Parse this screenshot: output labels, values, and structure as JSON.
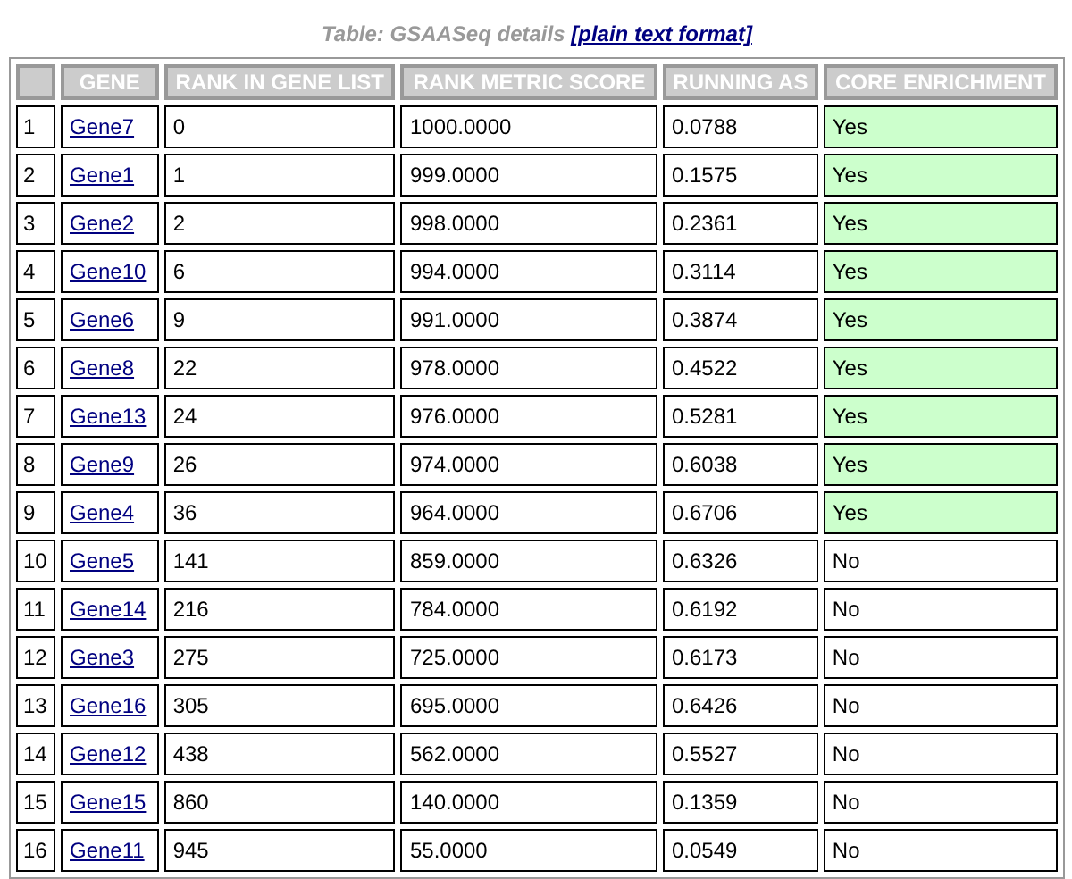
{
  "caption": {
    "title": "Table: GSAASeq details",
    "link": "[plain text format]"
  },
  "table": {
    "columns": [
      "",
      "GENE",
      "RANK IN GENE LIST",
      "RANK METRIC SCORE",
      "RUNNING AS",
      "CORE ENRICHMENT"
    ],
    "rows": [
      {
        "index": "1",
        "gene": "Gene7",
        "rank": "0",
        "score": "1000.0000",
        "running": "0.0788",
        "core": "Yes",
        "highlighted": true
      },
      {
        "index": "2",
        "gene": "Gene1",
        "rank": "1",
        "score": "999.0000",
        "running": "0.1575",
        "core": "Yes",
        "highlighted": true
      },
      {
        "index": "3",
        "gene": "Gene2",
        "rank": "2",
        "score": "998.0000",
        "running": "0.2361",
        "core": "Yes",
        "highlighted": true
      },
      {
        "index": "4",
        "gene": "Gene10",
        "rank": "6",
        "score": "994.0000",
        "running": "0.3114",
        "core": "Yes",
        "highlighted": true
      },
      {
        "index": "5",
        "gene": "Gene6",
        "rank": "9",
        "score": "991.0000",
        "running": "0.3874",
        "core": "Yes",
        "highlighted": true
      },
      {
        "index": "6",
        "gene": "Gene8",
        "rank": "22",
        "score": "978.0000",
        "running": "0.4522",
        "core": "Yes",
        "highlighted": true
      },
      {
        "index": "7",
        "gene": "Gene13",
        "rank": "24",
        "score": "976.0000",
        "running": "0.5281",
        "core": "Yes",
        "highlighted": true
      },
      {
        "index": "8",
        "gene": "Gene9",
        "rank": "26",
        "score": "974.0000",
        "running": "0.6038",
        "core": "Yes",
        "highlighted": true
      },
      {
        "index": "9",
        "gene": "Gene4",
        "rank": "36",
        "score": "964.0000",
        "running": "0.6706",
        "core": "Yes",
        "highlighted": true
      },
      {
        "index": "10",
        "gene": "Gene5",
        "rank": "141",
        "score": "859.0000",
        "running": "0.6326",
        "core": "No",
        "highlighted": false
      },
      {
        "index": "11",
        "gene": "Gene14",
        "rank": "216",
        "score": "784.0000",
        "running": "0.6192",
        "core": "No",
        "highlighted": false
      },
      {
        "index": "12",
        "gene": "Gene3",
        "rank": "275",
        "score": "725.0000",
        "running": "0.6173",
        "core": "No",
        "highlighted": false
      },
      {
        "index": "13",
        "gene": "Gene16",
        "rank": "305",
        "score": "695.0000",
        "running": "0.6426",
        "core": "No",
        "highlighted": false
      },
      {
        "index": "14",
        "gene": "Gene12",
        "rank": "438",
        "score": "562.0000",
        "running": "0.5527",
        "core": "No",
        "highlighted": false
      },
      {
        "index": "15",
        "gene": "Gene15",
        "rank": "860",
        "score": "140.0000",
        "running": "0.1359",
        "core": "No",
        "highlighted": false
      },
      {
        "index": "16",
        "gene": "Gene11",
        "rank": "945",
        "score": "55.0000",
        "running": "0.0549",
        "core": "No",
        "highlighted": false
      }
    ]
  }
}
